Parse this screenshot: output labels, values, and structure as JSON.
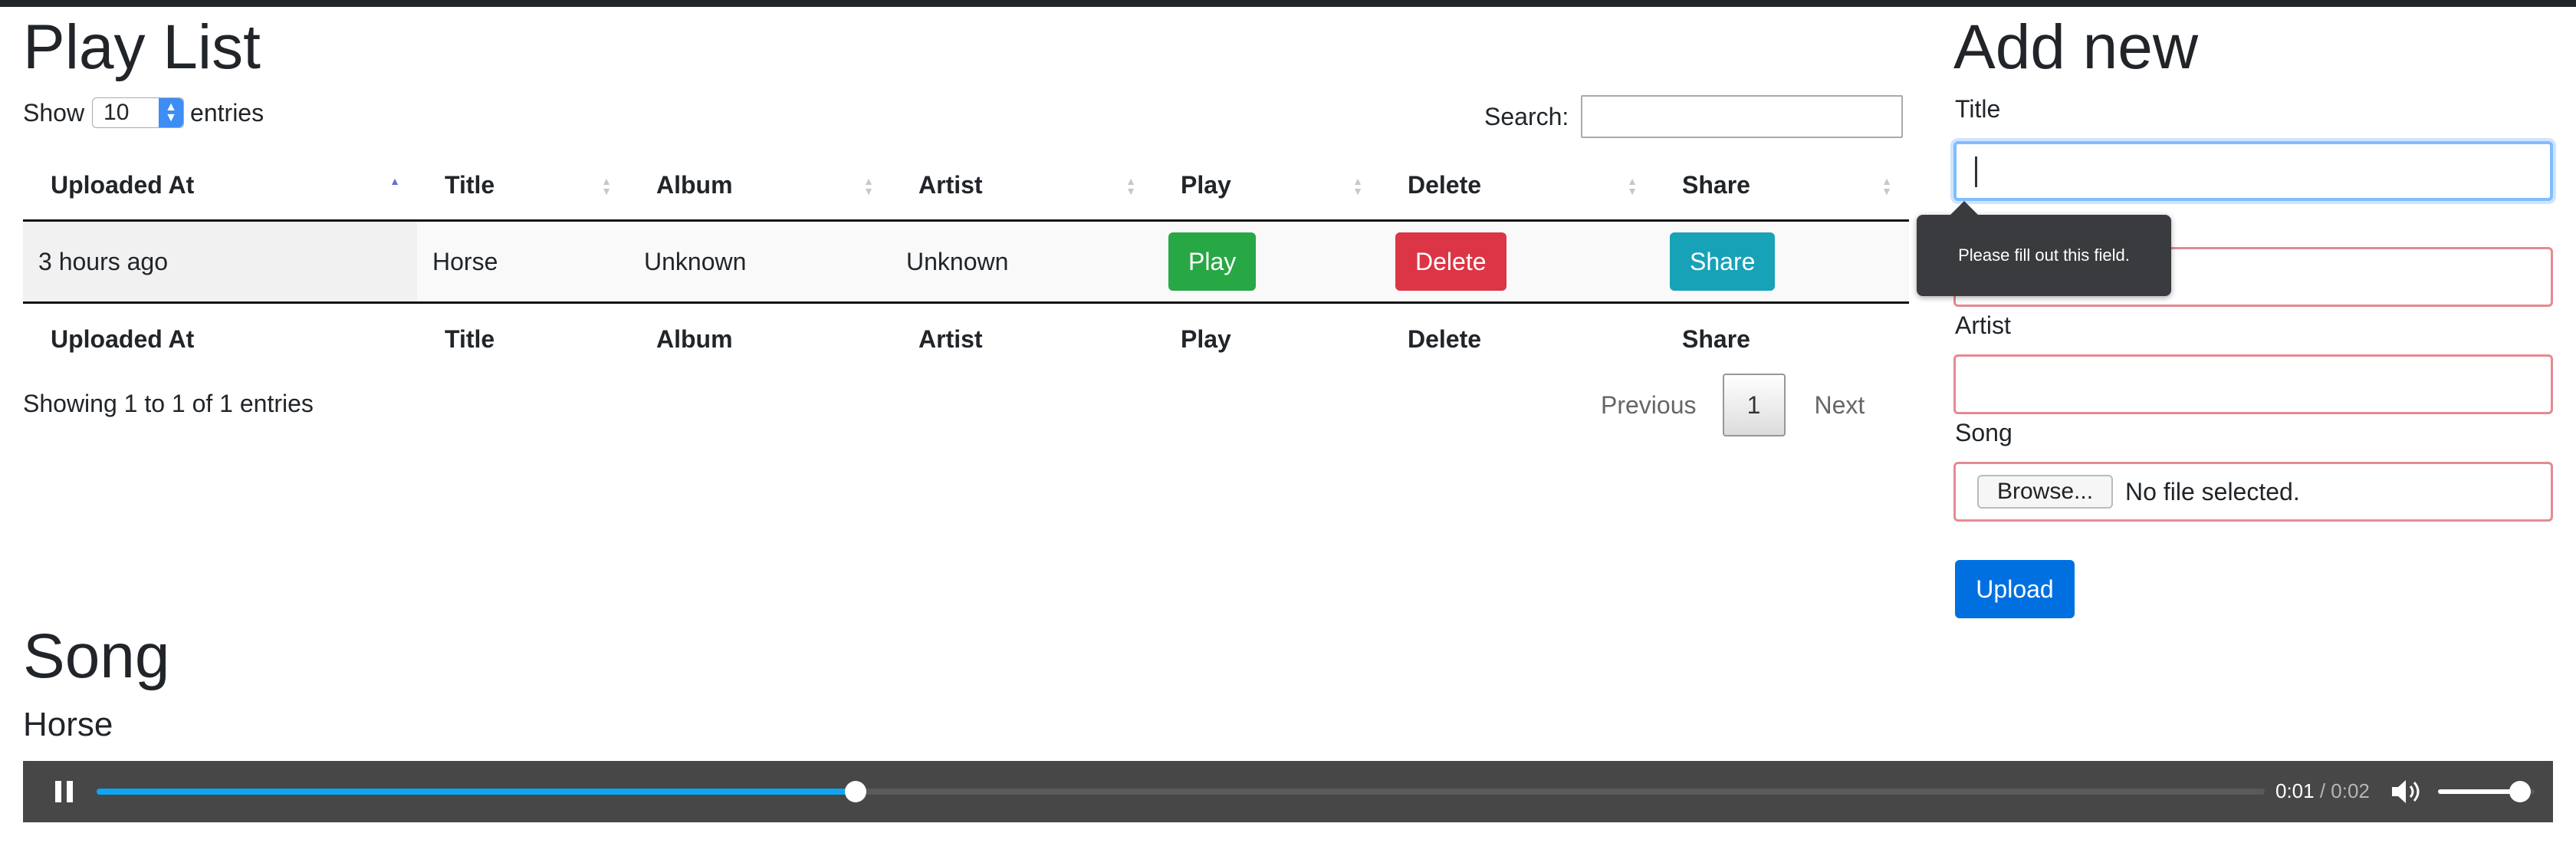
{
  "playlist": {
    "heading": "Play List",
    "length_menu": {
      "prefix": "Show",
      "value": "10",
      "suffix": "entries"
    },
    "search_label": "Search:",
    "search_value": "",
    "columns": [
      "Uploaded At",
      "Title",
      "Album",
      "Artist",
      "Play",
      "Delete",
      "Share"
    ],
    "sorted_column": "Uploaded At",
    "sort_direction": "ascending",
    "rows": [
      {
        "uploaded_at": "3 hours ago",
        "title": "Horse",
        "album": "Unknown",
        "artist": "Unknown",
        "play": "Play",
        "delete": "Delete",
        "share": "Share"
      }
    ],
    "info": "Showing 1 to 1 of 1 entries",
    "pagination": {
      "previous": "Previous",
      "current": "1",
      "next": "Next"
    }
  },
  "add_new": {
    "heading": "Add new",
    "title_label": "Title",
    "title_value": "",
    "album_value": "",
    "artist_label": "Artist",
    "artist_value": "",
    "song_label": "Song",
    "browse_label": "Browse...",
    "file_status": "No file selected.",
    "upload_label": "Upload",
    "validation_tooltip": "Please fill out this field."
  },
  "song": {
    "heading": "Song",
    "name": "Horse",
    "player": {
      "current_time": "0:01",
      "separator": " / ",
      "duration": "0:02",
      "progress": 0.35,
      "volume": 0.85,
      "state": "playing"
    }
  },
  "colors": {
    "play": "#28a745",
    "delete": "#dc3545",
    "share": "#17a2b8",
    "upload": "#0070e0",
    "player_bg": "#474747",
    "progress": "#0ea5f2",
    "invalid_border": "#e58a92",
    "focus_border": "#80bdff"
  },
  "icons": {
    "pause": "pause-icon",
    "volume": "volume-icon",
    "sort": "sort-icon"
  }
}
